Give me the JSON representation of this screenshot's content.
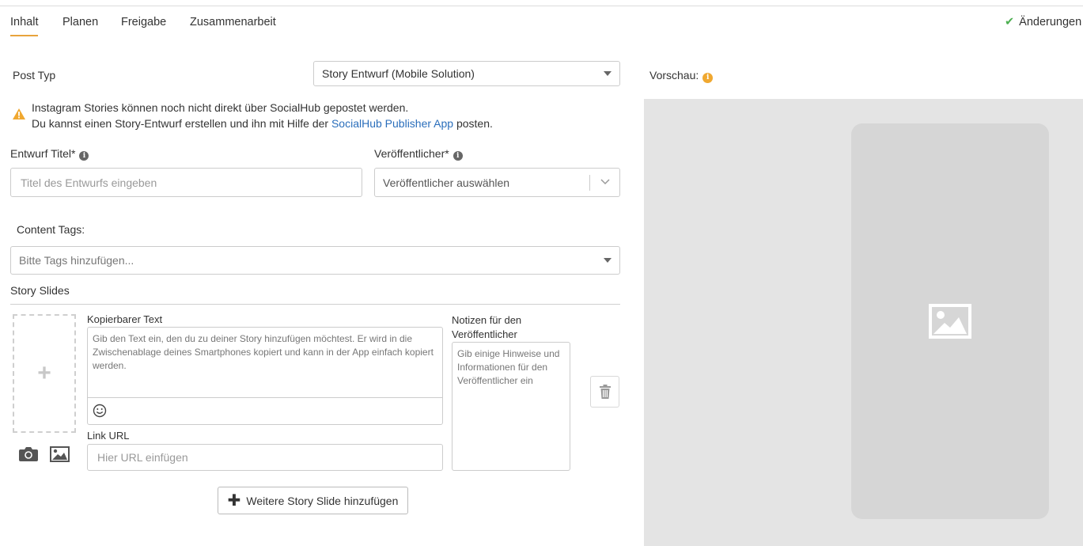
{
  "tabs": [
    {
      "label": "Inhalt",
      "active": true
    },
    {
      "label": "Planen",
      "active": false
    },
    {
      "label": "Freigabe",
      "active": false
    },
    {
      "label": "Zusammenarbeit",
      "active": false
    }
  ],
  "status": {
    "saved_label": "Änderungen"
  },
  "post_type": {
    "label": "Post Typ",
    "selected": "Story Entwurf (Mobile Solution)"
  },
  "warning": {
    "line1": "Instagram Stories können noch nicht direkt über SocialHub gepostet werden.",
    "line2_prefix": "Du kannst einen Story-Entwurf erstellen und ihn mit Hilfe der ",
    "line2_link": "SocialHub Publisher App",
    "line2_suffix": " posten."
  },
  "draft_title": {
    "label": "Entwurf Titel*",
    "placeholder": "Titel des Entwurfs eingeben"
  },
  "publisher": {
    "label": "Veröffentlicher*",
    "placeholder": "Veröffentlicher auswählen"
  },
  "content_tags": {
    "label": "Content Tags:",
    "placeholder": "Bitte Tags hinzufügen..."
  },
  "story_slides": {
    "heading": "Story Slides",
    "copy_text_label": "Kopierbarer Text",
    "copy_text_placeholder": "Gib den Text ein, den du zu deiner Story hinzufügen möchtest. Er wird in die Zwischenablage deines Smartphones kopiert und kann in der App einfach kopiert werden.",
    "link_url_label": "Link URL",
    "link_url_placeholder": "Hier URL einfügen",
    "notes_label_line1": "Notizen für den",
    "notes_label_line2": "Veröffentlicher",
    "notes_placeholder": "Gib einige Hinweise und Informationen für den Veröffentlicher ein",
    "add_slide_label": "Weitere Story Slide hinzufügen",
    "dropzone_plus": "+"
  },
  "preview": {
    "label": "Vorschau:"
  },
  "colors": {
    "accent": "#e8a33c",
    "link": "#2a6ebb",
    "success": "#4caf50",
    "warning": "#f0a830"
  }
}
